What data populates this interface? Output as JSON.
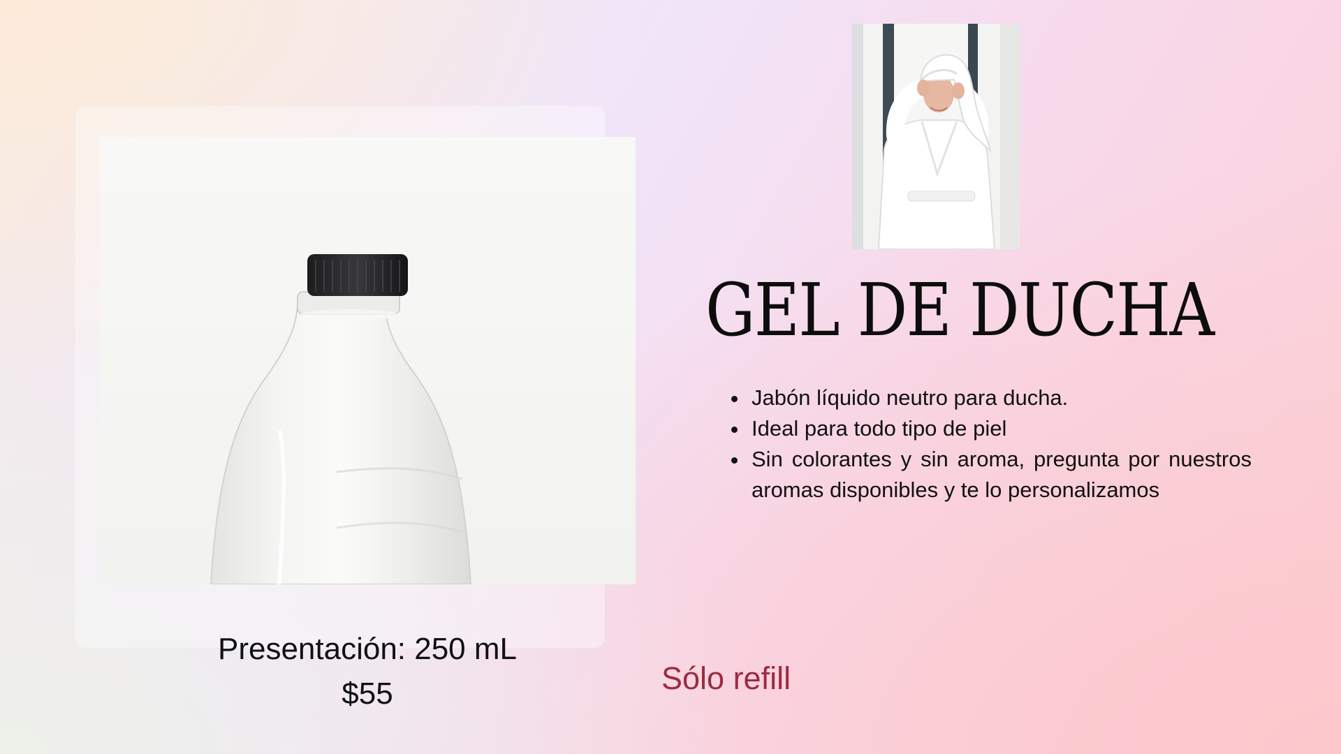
{
  "product": {
    "title": "GEL DE DUCHA",
    "features": [
      "Jabón líquido neutro para ducha.",
      "Ideal para todo tipo de piel",
      "Sin colorantes y sin aroma, pregunta por nuestros aromas disponibles y te lo personalizamos"
    ],
    "presentation": "Presentación: 250 mL",
    "price": "$55",
    "refill_note": "Sólo refill"
  },
  "colors": {
    "title": "#0d0d0d",
    "text": "#111111",
    "refill_note": "#9b2b42"
  },
  "images": {
    "bottle_photo": "glass-bottle-with-black-cap",
    "woman_photo": "woman-in-white-bathrobe-with-towel"
  }
}
